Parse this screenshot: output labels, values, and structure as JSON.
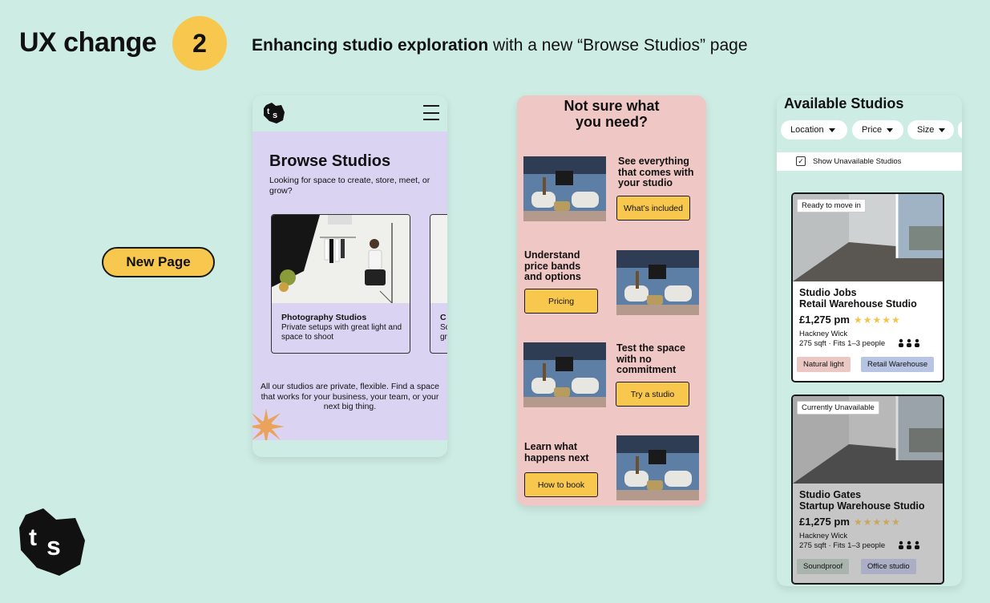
{
  "header": {
    "title": "UX change",
    "number": "2",
    "subtitle_bold": "Enhancing studio exploration",
    "subtitle_rest": " with a new “Browse Studios” page"
  },
  "new_page_label": "New Page",
  "phone1": {
    "heading": "Browse Studios",
    "subheading": "Looking for space to create, store, meet, or grow?",
    "card": {
      "title": "Photography Studios",
      "desc": "Private setups with great light and space to shoot"
    },
    "card2": {
      "title": "C",
      "desc_l1": "Sc",
      "desc_l2": "gr"
    },
    "body": "All our studios are private, flexible. Find a space that works for your business, your team, or your next big thing."
  },
  "phone2": {
    "title_l1": "Not sure what",
    "title_l2": "you need?",
    "sections": [
      {
        "text": "See everything that comes with your studio",
        "button": "What’s included"
      },
      {
        "text": "Understand price bands and options",
        "button": "Pricing"
      },
      {
        "text": "Test the space with no commitment",
        "button": "Try a studio"
      },
      {
        "text": "Learn what happens next",
        "button": "How to book"
      }
    ]
  },
  "phone3": {
    "title": "Available Studios",
    "filters": [
      "Location",
      "Price",
      "Size"
    ],
    "show_unavailable": "Show Unavailable Studios",
    "cards": [
      {
        "badge": "Ready to move in",
        "name_l1": "Studio Jobs",
        "name_l2": "Retail Warehouse Studio",
        "price": "£1,275 pm",
        "stars": "★★★★★",
        "location": "Hackney Wick",
        "details": "275 sqft · Fits 1–3 people",
        "tags": [
          "Natural light",
          "Retail Warehouse"
        ]
      },
      {
        "badge": "Currently Unavailable",
        "name_l1": "Studio Gates",
        "name_l2": "Startup Warehouse Studio",
        "price": "£1,275 pm",
        "stars": "★★★★★",
        "location": "Hackney Wick",
        "details": "275 sqft · Fits 1–3 people",
        "tags": [
          "Soundproof",
          "Office studio"
        ]
      }
    ]
  },
  "colors": {
    "background": "#cdece3",
    "accent_yellow": "#f8c84e",
    "lavender": "#dad3f2",
    "pink": "#efc7c5"
  }
}
